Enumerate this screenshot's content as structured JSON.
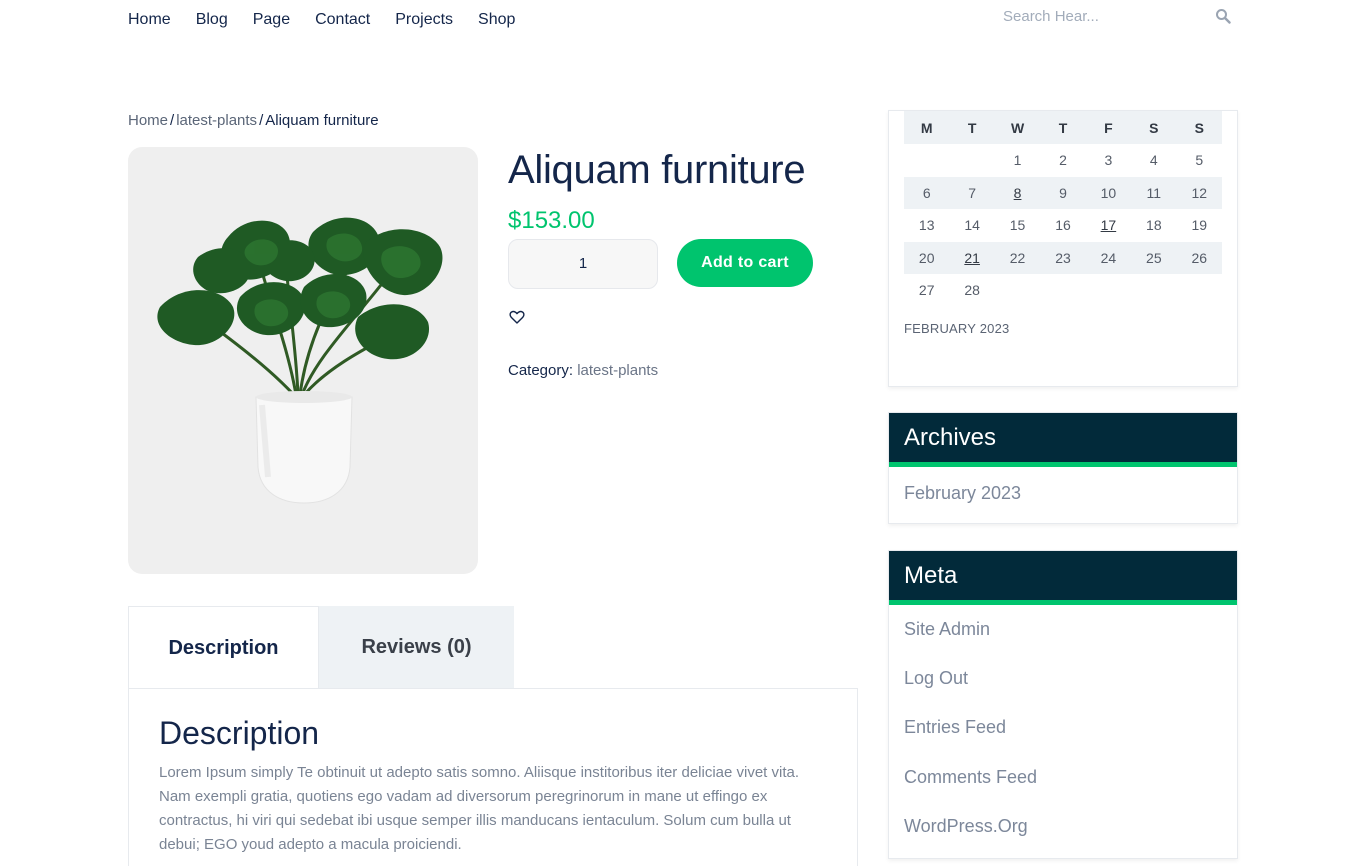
{
  "nav": {
    "items": [
      "Home",
      "Blog",
      "Page",
      "Contact",
      "Projects",
      "Shop"
    ]
  },
  "search": {
    "placeholder": "Search Hear..."
  },
  "breadcrumb": {
    "home": "Home",
    "sep1": "/",
    "category": "latest-plants",
    "sep2": "/",
    "current": "Aliquam furniture"
  },
  "product": {
    "title": "Aliquam furniture",
    "price": "$153.00",
    "quantity": "1",
    "add_to_cart": "Add to cart",
    "category_label": "Category:",
    "category_value": "latest-plants"
  },
  "tabs": {
    "description": "Description",
    "reviews": "Reviews (0)"
  },
  "description_panel": {
    "title": "Description",
    "text": "Lorem Ipsum simply Te obtinuit ut adepto satis somno. Aliisque institoribus iter deliciae vivet vita. Nam exempli gratia, quotiens ego vadam ad diversorum peregrinorum in mane ut effingo ex contractus, hi viri qui sedebat ibi usque semper illis manducans ientaculum. Solum cum bulla ut debui; EGO youd adepto a macula proiciendi."
  },
  "calendar": {
    "days": [
      "M",
      "T",
      "W",
      "T",
      "F",
      "S",
      "S"
    ],
    "weeks": [
      [
        "",
        "",
        "1",
        "2",
        "3",
        "4",
        "5"
      ],
      [
        "6",
        "7",
        "8",
        "9",
        "10",
        "11",
        "12"
      ],
      [
        "13",
        "14",
        "15",
        "16",
        "17",
        "18",
        "19"
      ],
      [
        "20",
        "21",
        "22",
        "23",
        "24",
        "25",
        "26"
      ],
      [
        "27",
        "28",
        "",
        "",
        "",
        "",
        ""
      ]
    ],
    "linked_days": [
      "8",
      "17",
      "21"
    ],
    "caption": "FEBRUARY 2023"
  },
  "archives": {
    "title": "Archives",
    "items": [
      "February 2023"
    ]
  },
  "meta": {
    "title": "Meta",
    "items": [
      "Site Admin",
      "Log Out",
      "Entries Feed",
      "Comments Feed",
      "WordPress.Org"
    ]
  },
  "colors": {
    "accent_green": "#00c46e",
    "navy_text": "#14264a",
    "widget_header": "#022a3a"
  },
  "icons": {
    "search": "search-icon",
    "wishlist": "heart-icon"
  }
}
